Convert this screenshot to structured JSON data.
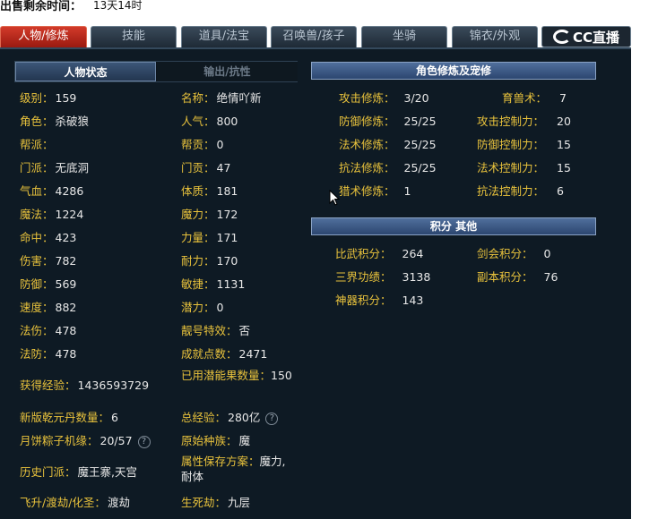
{
  "sale_time": {
    "label": "出售剩余时间：",
    "value": "13天14时"
  },
  "tabs": [
    {
      "label": "人物/修炼",
      "active": true
    },
    {
      "label": "技能"
    },
    {
      "label": "道具/法宝"
    },
    {
      "label": "召唤兽/孩子"
    },
    {
      "label": "坐骑"
    },
    {
      "label": "锦衣/外观"
    }
  ],
  "logo": {
    "text": "CC直播"
  },
  "subtabs": {
    "char_status": "人物状态",
    "output_resist": "输出/抗性"
  },
  "left_stats": [
    {
      "label": "级别：",
      "value": "159"
    },
    {
      "label": "角色：",
      "value": "杀破狼"
    },
    {
      "label": "帮派：",
      "value": ""
    },
    {
      "label": "门派：",
      "value": "无底洞"
    },
    {
      "label": "气血：",
      "value": "4286"
    },
    {
      "label": "魔法：",
      "value": "1224"
    },
    {
      "label": "命中：",
      "value": "423"
    },
    {
      "label": "伤害：",
      "value": "782"
    },
    {
      "label": "防御：",
      "value": "569"
    },
    {
      "label": "速度：",
      "value": "882"
    },
    {
      "label": "法伤：",
      "value": "478"
    },
    {
      "label": "法防：",
      "value": "478"
    },
    {
      "label": "获得经验：",
      "value": "1436593729"
    },
    {
      "label": "新版乾元丹数量：",
      "value": "6"
    },
    {
      "label": "月饼粽子机缘：",
      "value": "20/57"
    },
    {
      "label": "历史门派：",
      "value": "魔王寨,天宫"
    },
    {
      "label": "飞升/渡劫/化圣：",
      "value": "渡劫"
    }
  ],
  "right_stats": [
    {
      "label": "名称：",
      "value": "绝情吖新"
    },
    {
      "label": "人气：",
      "value": "800"
    },
    {
      "label": "帮贡：",
      "value": "0"
    },
    {
      "label": "门贡：",
      "value": "47"
    },
    {
      "label": "体质：",
      "value": "181"
    },
    {
      "label": "魔力：",
      "value": "172"
    },
    {
      "label": "力量：",
      "value": "171"
    },
    {
      "label": "耐力：",
      "value": "170"
    },
    {
      "label": "敏捷：",
      "value": "1131"
    },
    {
      "label": "潜力：",
      "value": "0"
    },
    {
      "label": "靓号特效：",
      "value": "否"
    },
    {
      "label": "成就点数：",
      "value": "2471"
    },
    {
      "label": "已用潜能果数量：",
      "value": "150"
    },
    {
      "label": "总经验：",
      "value": "280亿"
    },
    {
      "label": "原始种族：",
      "value": "魔"
    },
    {
      "label": "属性保存方案：",
      "value": "魔力,耐体"
    },
    {
      "label": "生死劫：",
      "value": "九层"
    }
  ],
  "cultivation": {
    "title": "角色修炼及宠修",
    "items": [
      {
        "label": "攻击修炼：",
        "value": "3/20"
      },
      {
        "label": "育兽术：",
        "value": "7"
      },
      {
        "label": "防御修炼：",
        "value": "25/25"
      },
      {
        "label": "攻击控制力：",
        "value": "20"
      },
      {
        "label": "法术修炼：",
        "value": "25/25"
      },
      {
        "label": "防御控制力：",
        "value": "15"
      },
      {
        "label": "抗法修炼：",
        "value": "25/25"
      },
      {
        "label": "法术控制力：",
        "value": "15"
      },
      {
        "label": "猎术修炼：",
        "value": "1"
      },
      {
        "label": "抗法控制力：",
        "value": "6"
      }
    ]
  },
  "points": {
    "title": "积分  其他",
    "items": [
      {
        "label": "比武积分：",
        "value": "264"
      },
      {
        "label": "剑会积分：",
        "value": "0"
      },
      {
        "label": "三界功绩：",
        "value": "3138"
      },
      {
        "label": "副本积分：",
        "value": "76"
      },
      {
        "label": "神器积分：",
        "value": "143"
      }
    ]
  }
}
